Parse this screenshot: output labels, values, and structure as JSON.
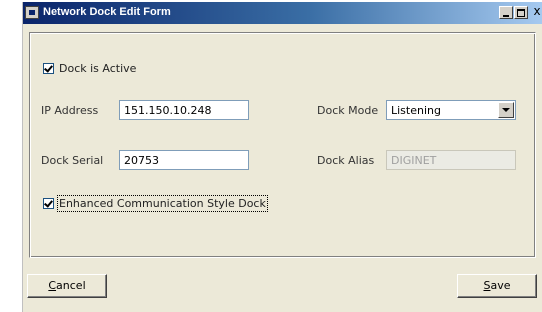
{
  "window": {
    "title": "Network Dock Edit Form",
    "close_glyph": "x"
  },
  "form": {
    "dock_active": {
      "label": "Dock is Active",
      "checked": true
    },
    "ip_address": {
      "label": "IP Address",
      "value": "151.150.10.248"
    },
    "dock_mode": {
      "label": "Dock Mode",
      "value": "Listening"
    },
    "dock_serial": {
      "label": "Dock Serial",
      "value": "20753"
    },
    "dock_alias": {
      "label": "Dock Alias",
      "value": "DIGINET"
    },
    "enhanced_comm": {
      "label": "Enhanced Communication Style Dock",
      "checked": true
    }
  },
  "buttons": {
    "cancel": {
      "mnemonic": "C",
      "rest": "ancel"
    },
    "save": {
      "mnemonic": "S",
      "rest": "ave"
    }
  }
}
